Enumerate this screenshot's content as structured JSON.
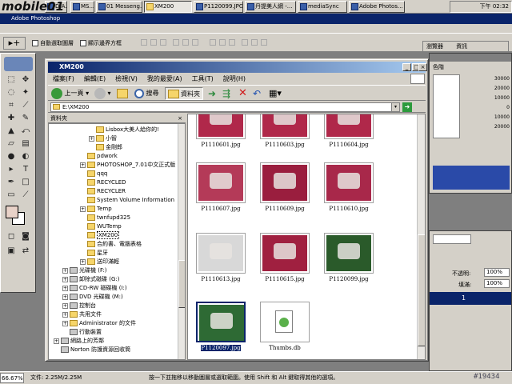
{
  "brand": "mobile01",
  "watermark": "#19434",
  "taskbar": {
    "buttons": [
      "D A...",
      "MS...",
      "01 Messeng...",
      "XM200",
      "P1120099.JPG...",
      "丹提美人網 -...",
      "mediaSync",
      "Adobe Photos..."
    ],
    "clock": "下午 02:32"
  },
  "photoshop": {
    "title": "Adobe Photoshop",
    "options": {
      "auto_select": "自動選取圖層",
      "show_bounds": "顯示邊界方框"
    },
    "palette_tabs": [
      "瀏覽器",
      "資訊",
      "色階"
    ],
    "ruler_numbers": [
      "30000",
      "20000",
      "10000",
      "0",
      "10000",
      "20000"
    ],
    "zoom": "66.67%",
    "doc_info": "文件: 2.25M/2.25M",
    "status_hint": "按一下並拖移以移動圖層或選取範圍。使用 Shift 和 Alt 鍵取得其他的選項。",
    "layer_panel": {
      "opacity_label": "不透明:",
      "opacity_value": "100%",
      "fill_label": "填滿:",
      "fill_value": "100%",
      "layer_name": "1"
    }
  },
  "explorer": {
    "title": "XM200",
    "menu": [
      "檔案(F)",
      "編輯(E)",
      "檢視(V)",
      "我的最愛(A)",
      "工具(T)",
      "說明(H)"
    ],
    "toolbar": {
      "back": "上一頁",
      "search": "搜尋",
      "folders": "資料夾"
    },
    "address": "E:\\XM200",
    "tree_header": "資料夾",
    "tree": [
      {
        "label": "Lisbox大美人給你的!",
        "type": "folder",
        "indent": 4
      },
      {
        "label": "小智",
        "type": "folder",
        "indent": 4,
        "expander": "+"
      },
      {
        "label": "金剛郎",
        "type": "folder",
        "indent": 4
      },
      {
        "label": "pdwork",
        "type": "folder",
        "indent": 3
      },
      {
        "label": "PHOTOSHOP_7.01中文正式版",
        "type": "folder",
        "indent": 3,
        "expander": "+"
      },
      {
        "label": "qqq",
        "type": "folder",
        "indent": 3
      },
      {
        "label": "RECYCLED",
        "type": "folder",
        "indent": 3
      },
      {
        "label": "RECYCLER",
        "type": "folder",
        "indent": 3
      },
      {
        "label": "System Volume Information",
        "type": "folder",
        "indent": 3
      },
      {
        "label": "Temp",
        "type": "folder",
        "indent": 3,
        "expander": "+"
      },
      {
        "label": "twnfupd325",
        "type": "folder",
        "indent": 3
      },
      {
        "label": "WUTemp",
        "type": "folder",
        "indent": 3
      },
      {
        "label": "XM200",
        "type": "folder",
        "indent": 3,
        "selected": true
      },
      {
        "label": "合約書、電腦表格",
        "type": "folder",
        "indent": 3
      },
      {
        "label": "星牙",
        "type": "folder",
        "indent": 3
      },
      {
        "label": "送印滿輕",
        "type": "folder",
        "indent": 3,
        "expander": "+"
      },
      {
        "label": "光碟機 (F:)",
        "type": "drive",
        "indent": 1,
        "expander": "+"
      },
      {
        "label": "卸除式磁碟 (G:)",
        "type": "drive",
        "indent": 1,
        "expander": "+"
      },
      {
        "label": "CD-RW 磁碟機 (I:)",
        "type": "drive",
        "indent": 1,
        "expander": "+"
      },
      {
        "label": "DVD 光碟機 (M:)",
        "type": "drive",
        "indent": 1,
        "expander": "+"
      },
      {
        "label": "控制台",
        "type": "drive",
        "indent": 1,
        "expander": "+"
      },
      {
        "label": "共用文件",
        "type": "folder",
        "indent": 1,
        "expander": "+"
      },
      {
        "label": "Administrator 的文件",
        "type": "folder",
        "indent": 1,
        "expander": "+"
      },
      {
        "label": "行動裝置",
        "type": "drive",
        "indent": 1
      },
      {
        "label": "網路上的芳鄰",
        "type": "drive",
        "indent": 0,
        "expander": "+"
      },
      {
        "label": "Norton 防護資源回收筒",
        "type": "drive",
        "indent": 0
      }
    ],
    "files": [
      {
        "name": "P1110601.jpg",
        "color": "#b0284a"
      },
      {
        "name": "P1110603.jpg",
        "color": "#b0284a"
      },
      {
        "name": "P1110604.jpg",
        "color": "#b0284a"
      },
      {
        "name": "P1110607.jpg",
        "color": "#b43a58"
      },
      {
        "name": "P1110609.jpg",
        "color": "#9a1e3e"
      },
      {
        "name": "P1110610.jpg",
        "color": "#a8284a"
      },
      {
        "name": "P1110613.jpg",
        "color": "#d8d8d8"
      },
      {
        "name": "P1110615.jpg",
        "color": "#a02040"
      },
      {
        "name": "P1120099.jpg",
        "color": "#2a5a2a"
      },
      {
        "name": "P1120097.jpg",
        "color": "#2e6a34",
        "selected": true
      },
      {
        "name": "Thumbs.db",
        "color": "#ffffff"
      }
    ]
  }
}
